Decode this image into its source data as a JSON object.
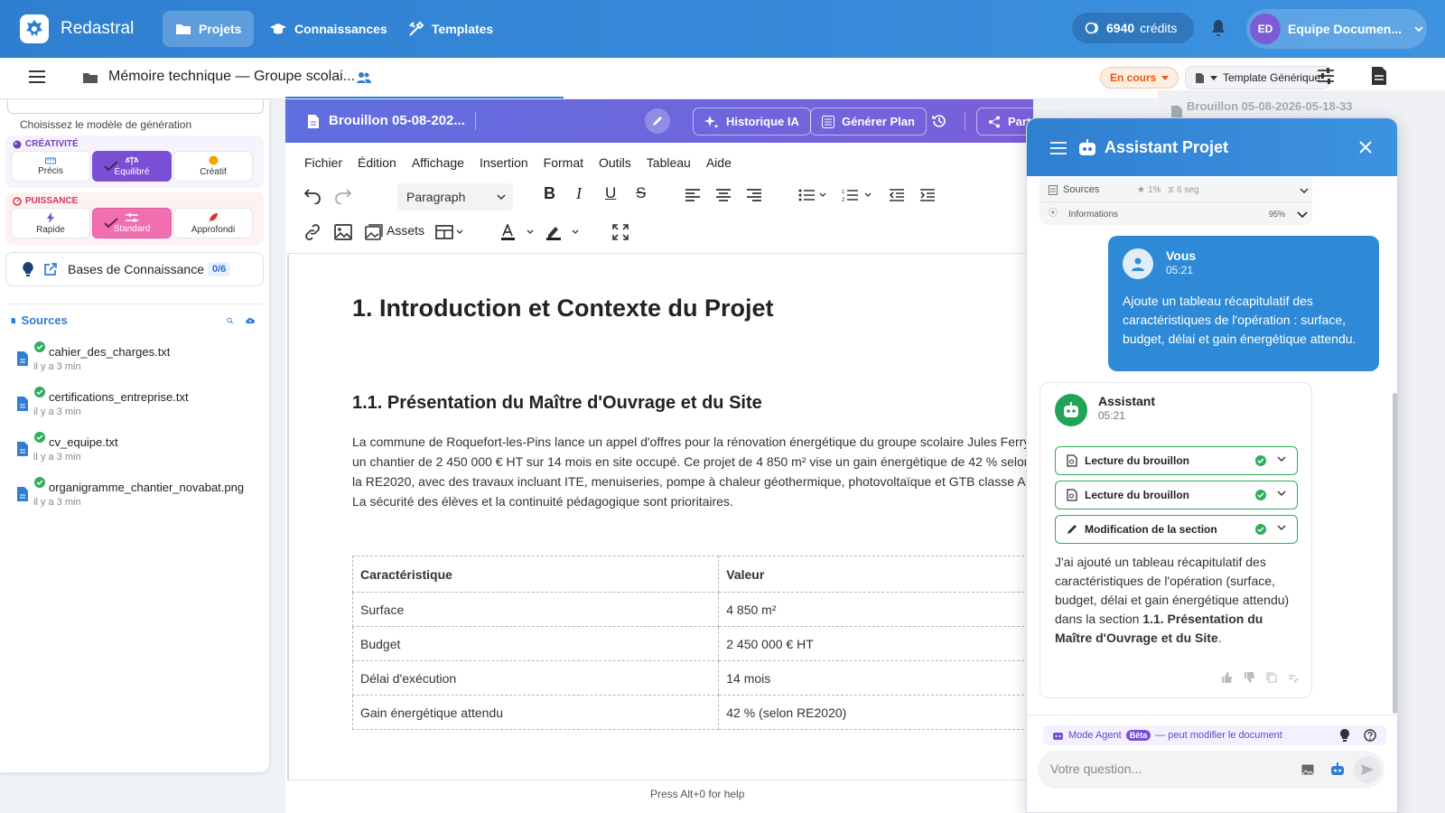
{
  "topbar": {
    "app_name": "Redastral",
    "nav": [
      "Projets",
      "Connaissances",
      "Templates"
    ],
    "credits_value": "6940",
    "credits_label": "crédits",
    "user_initials": "ED",
    "user_name": "Equipe Documen..."
  },
  "subbar": {
    "doc_title": "Mémoire technique — Groupe scolai...",
    "status": "En cours",
    "template": "Template Générique"
  },
  "left_panel": {
    "model_hint": "Choisissez le modèle de génération",
    "creativity": {
      "label": "CRÉATIVITÉ",
      "options": [
        "Précis",
        "Équilibré",
        "Créatif"
      ],
      "selected": "Équilibré"
    },
    "power": {
      "label": "PUISSANCE",
      "options": [
        "Rapide",
        "Standard",
        "Approfondi"
      ],
      "selected": "Standard"
    },
    "knowledge_bases": {
      "label": "Bases de Connaissance",
      "count": "0/6"
    },
    "sources": {
      "label": "Sources",
      "items": [
        {
          "name": "cahier_des_charges.txt",
          "time": "il y a 3 min"
        },
        {
          "name": "certifications_entreprise.txt",
          "time": "il y a 3 min"
        },
        {
          "name": "cv_equipe.txt",
          "time": "il y a 3 min"
        },
        {
          "name": "organigramme_chantier_novabat.png",
          "time": "il y a 3 min"
        }
      ]
    }
  },
  "editor": {
    "draft_title": "Brouillon 05-08-202...",
    "buttons": {
      "history_ai": "Historique IA",
      "generate_plan": "Générer Plan",
      "share": "Part"
    },
    "menu": [
      "Fichier",
      "Édition",
      "Affichage",
      "Insertion",
      "Format",
      "Outils",
      "Tableau",
      "Aide"
    ],
    "paragraph_style": "Paragraph",
    "assets_label": "Assets",
    "help_text": "Press Alt+0 for help"
  },
  "document": {
    "h1": "1. Introduction et Contexte du Projet",
    "h2": "1.1. Présentation du Maître d'Ouvrage et du Site",
    "paragraph": "La commune de Roquefort-les-Pins lance un appel d'offres pour la rénovation énergétique du groupe scolaire Jules Ferry, un chantier de 2 450 000 € HT sur 14 mois en site occupé. Ce projet de 4 850 m² vise un gain énergétique de 42 % selon la RE2020, avec des travaux incluant ITE, menuiseries, pompe à chaleur géothermique, photovoltaïque et GTB classe A. La sécurité des élèves et la continuité pédagogique sont prioritaires.",
    "table": {
      "headers": [
        "Caractéristique",
        "Valeur"
      ],
      "rows": [
        [
          "Surface",
          "4 850 m²"
        ],
        [
          "Budget",
          "2 450 000 € HT"
        ],
        [
          "Délai d'exécution",
          "14 mois"
        ],
        [
          "Gain énergétique attendu",
          "42 % (selon RE2020)"
        ]
      ]
    }
  },
  "right_strip": {
    "draft_label": "Brouillon 05-08-2026-05-18-33"
  },
  "assistant": {
    "title": "Assistant Projet",
    "sources_row": {
      "label": "Sources",
      "stars": "1%",
      "time": "6 seg."
    },
    "info_row": {
      "label": "Informations",
      "pct": "95%"
    },
    "user_msg": {
      "name": "Vous",
      "time": "05:21",
      "text": "Ajoute un tableau récapitulatif des caractéristiques de l'opération : surface, budget, délai et gain énergétique attendu."
    },
    "bot_msg": {
      "name": "Assistant",
      "time": "05:21",
      "steps": [
        "Lecture du brouillon",
        "Lecture du brouillon",
        "Modification de la section"
      ],
      "text_before": "J'ai ajouté un tableau récapitulatif des caractéristiques de l'opération (surface, budget, délai et gain énergétique attendu) dans la section ",
      "text_bold": "1.1. Présentation du Maître d'Ouvrage et du Site",
      "text_after": "."
    },
    "agent_mode": {
      "label": "Mode Agent",
      "beta": "Bêta",
      "note": "— peut modifier le document"
    },
    "input_placeholder": "Votre question..."
  },
  "colors": {
    "topbar": "#2f7fd0",
    "editor_header": "#6a66de",
    "user_bubble": "#2e8ad6",
    "success": "#2fae5d",
    "status_orange": "#e8590c"
  }
}
